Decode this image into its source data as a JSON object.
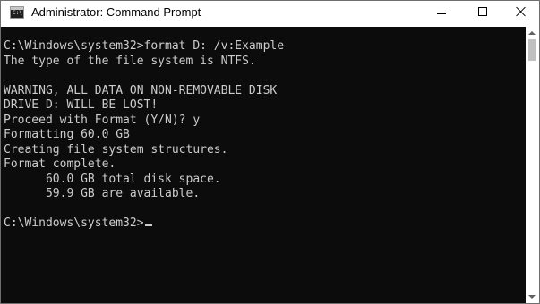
{
  "window": {
    "title": "Administrator: Command Prompt",
    "icon": "cmd-icon",
    "icon_label": "C:\\"
  },
  "controls": {
    "minimize": "minimize-icon",
    "maximize": "maximize-icon",
    "close": "close-icon"
  },
  "console": {
    "lines": [
      "C:\\Windows\\system32>format D: /v:Example",
      "The type of the file system is NTFS.",
      "",
      "WARNING, ALL DATA ON NON-REMOVABLE DISK",
      "DRIVE D: WILL BE LOST!",
      "Proceed with Format (Y/N)? y",
      "Formatting 60.0 GB",
      "Creating file system structures.",
      "Format complete.",
      "      60.0 GB total disk space.",
      "      59.9 GB are available.",
      ""
    ],
    "prompt": "C:\\Windows\\system32>"
  },
  "colors": {
    "console_bg": "#0c0c0c",
    "console_fg": "#cccccc",
    "titlebar_bg": "#ffffff"
  }
}
